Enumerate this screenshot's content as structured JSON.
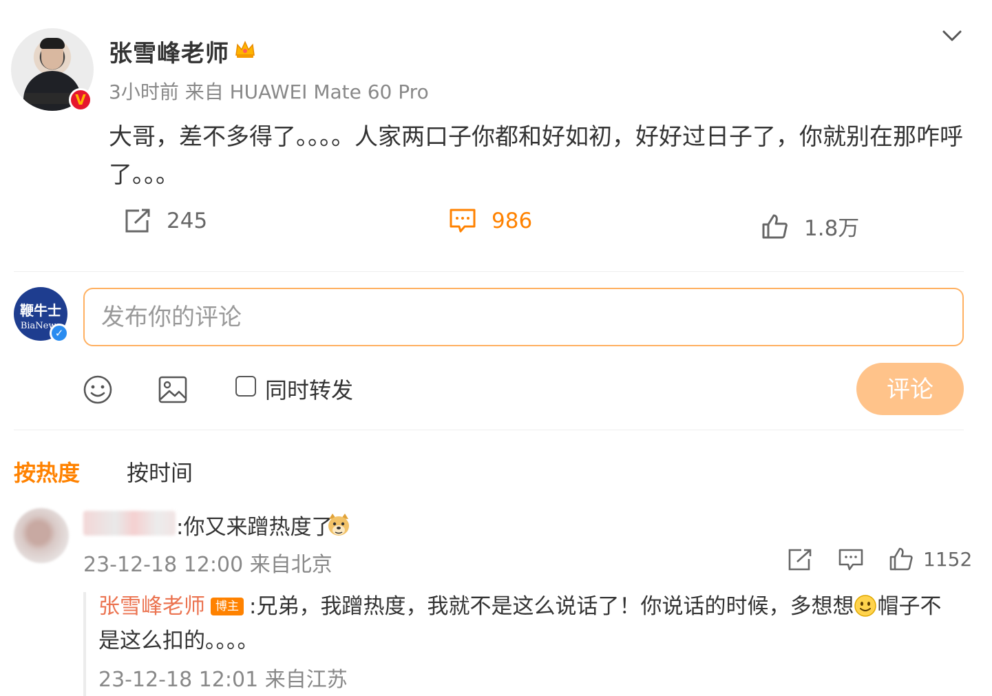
{
  "post": {
    "author": "张雪峰老师",
    "meta": "3小时前 来自 HUAWEI Mate 60 Pro",
    "text": "大哥，差不多得了。。。。人家两口子你都和好如初，好好过日子了，你就别在那咋呼了。。。",
    "repost_count": "245",
    "comment_count": "986",
    "like_count": "1.8万"
  },
  "composer": {
    "avatar_line1": "鞭牛士",
    "avatar_line2": "BiaNews",
    "placeholder": "发布你的评论",
    "repost_label": "同时转发",
    "submit_label": "评论"
  },
  "sort_tabs": {
    "hot": "按热度",
    "time": "按时间"
  },
  "comments": [
    {
      "text": ":你又来蹭热度了",
      "meta": "23-12-18 12:00 来自北京",
      "like_count": "1152",
      "reply": {
        "author": "张雪峰老师",
        "badge": "博主",
        "text_before": ":兄弟，我蹭热度，我就不是这么说话了！你说话的时候，多想想",
        "text_after": "帽子不是这么扣的。。。。",
        "meta": "23-12-18 12:01 来自江苏"
      }
    }
  ],
  "colors": {
    "accent": "#ff8200",
    "reply_author": "#eb7350",
    "verified_red": "#e6162d",
    "verified_blue": "#2a8cf0",
    "input_border": "#ffb060",
    "submit_bg": "#ffc38a"
  },
  "icons": {
    "crown": "crown-icon",
    "chevron": "chevron-down-icon",
    "repost": "repost-icon",
    "comment": "comment-icon",
    "like": "like-icon",
    "emoji": "emoji-icon",
    "image": "image-icon",
    "doge": "doge-emoji-icon",
    "smile": "smile-emoji-icon"
  }
}
